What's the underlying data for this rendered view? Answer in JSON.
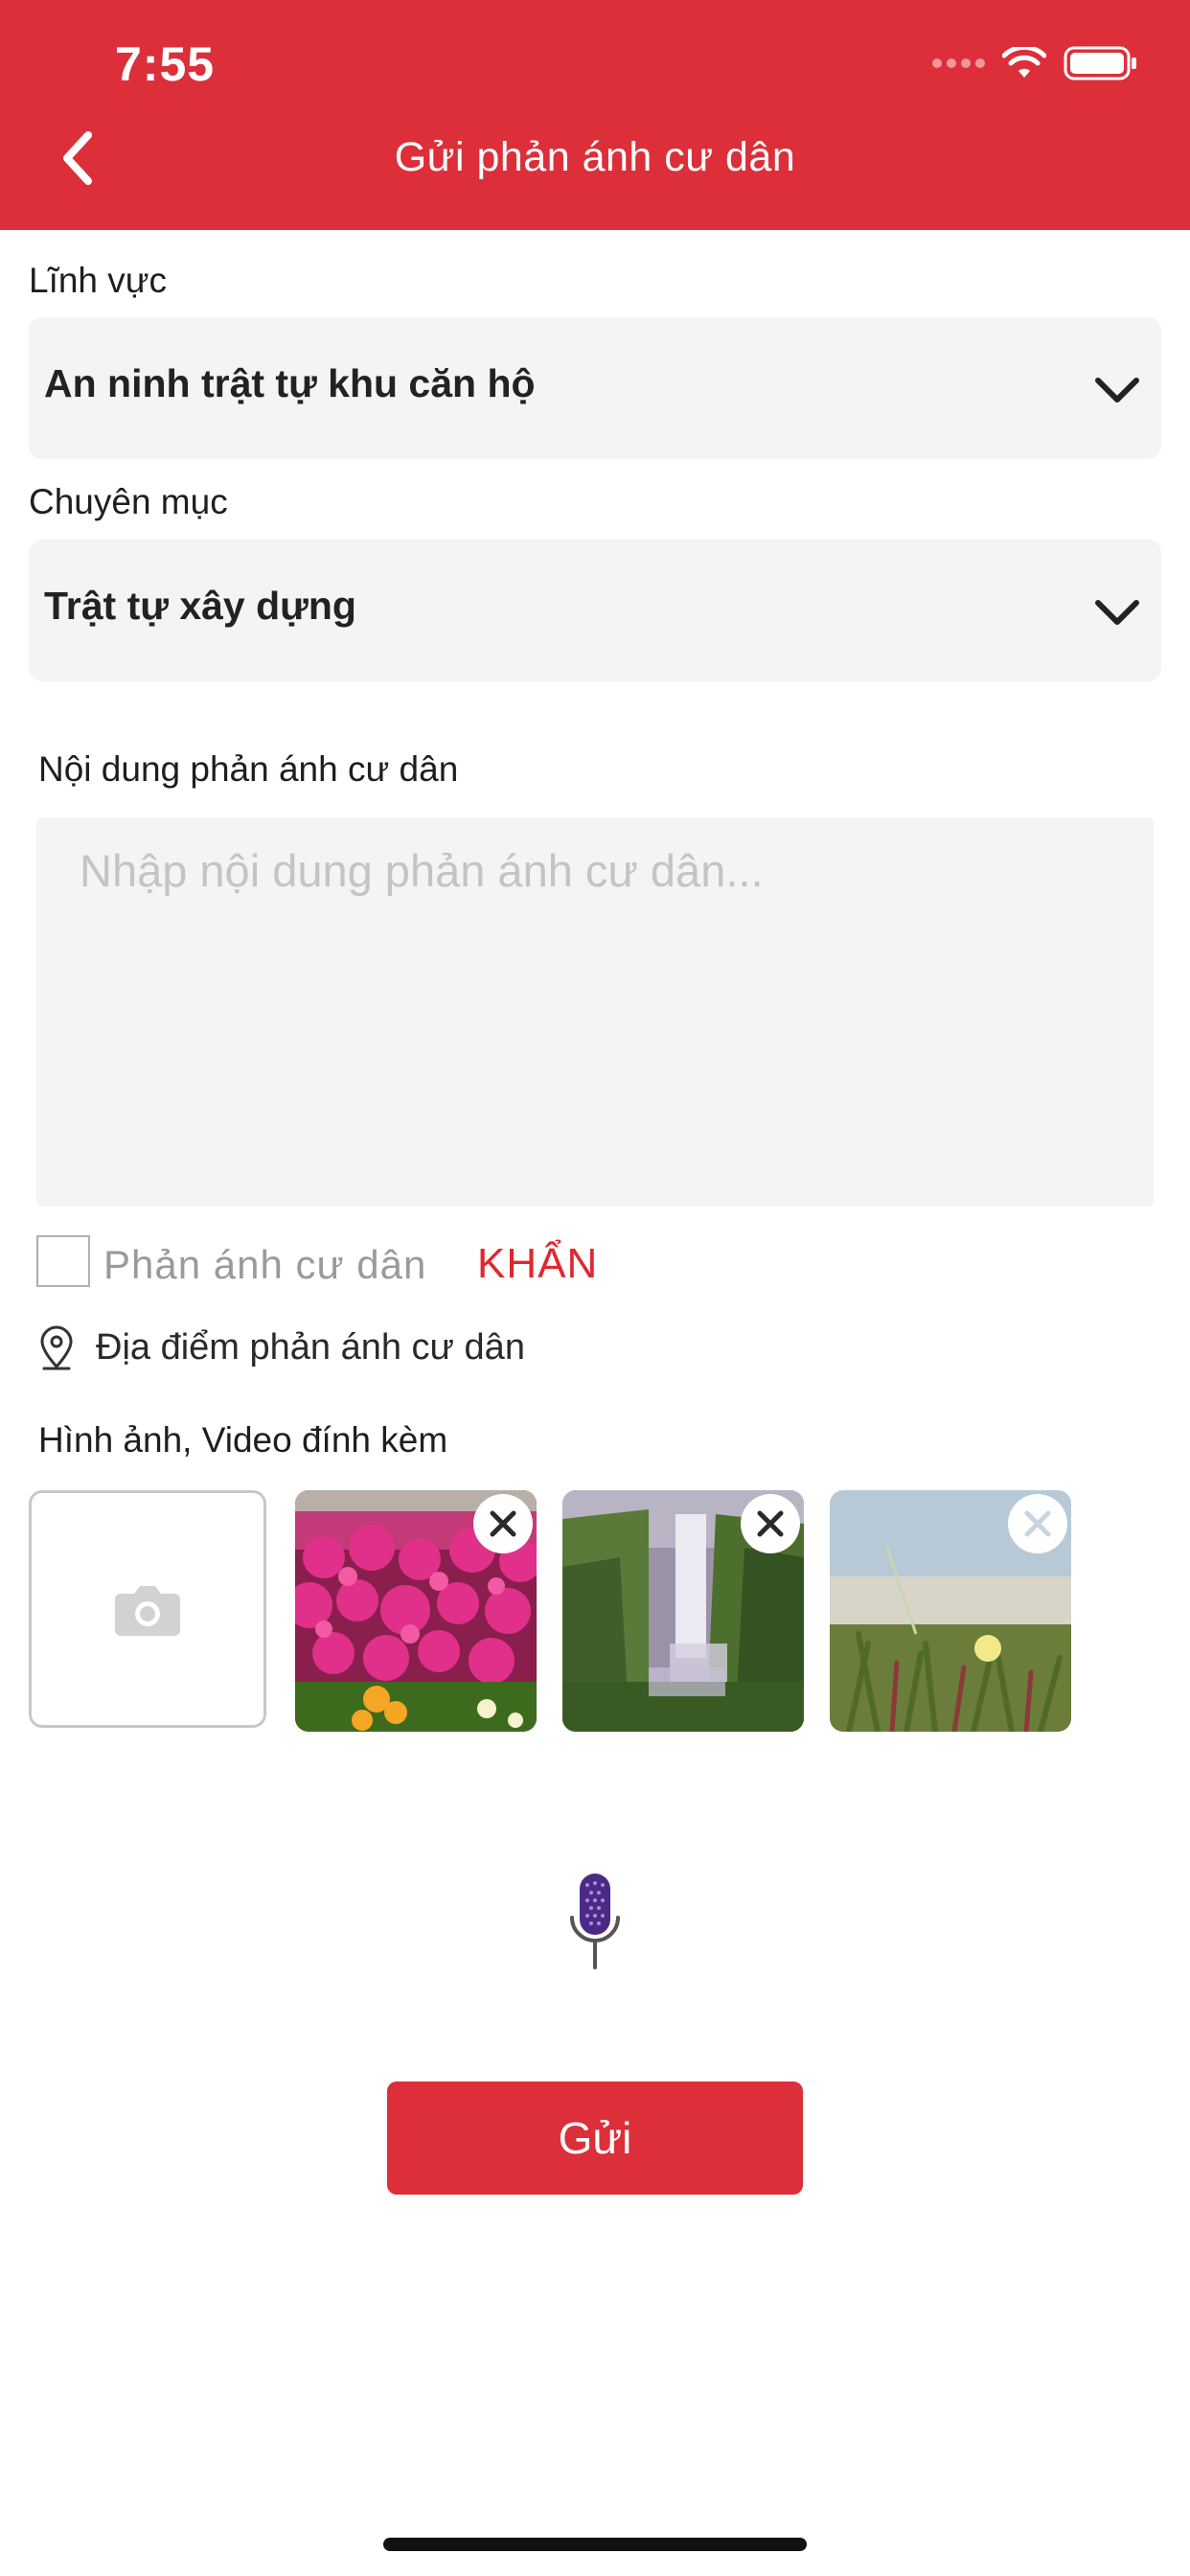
{
  "status_bar": {
    "time": "7:55"
  },
  "header": {
    "title": "Gửi phản ánh cư dân"
  },
  "form": {
    "field_label": "Lĩnh vực",
    "field_value": "An ninh trật tự khu căn hộ",
    "category_label": "Chuyên mục",
    "category_value": "Trật tự xây dựng",
    "content_label": "Nội dung phản ánh cư dân",
    "content_placeholder": "Nhập nội dung phản ánh cư dân...",
    "urgent_label": "Phản ánh cư dân",
    "urgent_tag": "KHẨN",
    "location_label": "Địa điểm phản ánh cư dân",
    "attachments_label": "Hình ảnh, Video đính kèm"
  },
  "attachments": [
    {
      "name": "flowers-photo"
    },
    {
      "name": "waterfall-photo"
    },
    {
      "name": "beach-plants-photo"
    }
  ],
  "submit_label": "Gửi",
  "colors": {
    "brand": "#dc2f3a",
    "urgent": "#e0262f"
  }
}
